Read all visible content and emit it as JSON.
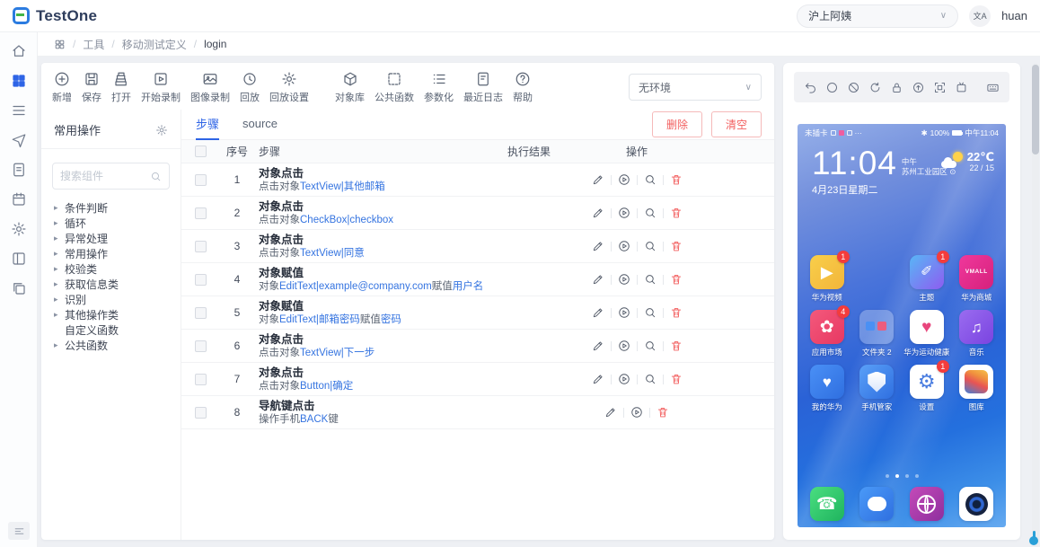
{
  "header": {
    "logo": "TestOne",
    "org": "沪上阿姨",
    "translate": "文A",
    "user": "huan",
    "chevron": "∨"
  },
  "breadcrumb": {
    "items": [
      "工具",
      "移动测试定义",
      "login"
    ],
    "separator": "/"
  },
  "rail": {
    "icons": [
      "home",
      "apps",
      "list",
      "send",
      "doc",
      "calendar",
      "gear",
      "split",
      "windows"
    ],
    "active_index": 1
  },
  "toolbar": {
    "buttons": [
      {
        "label": "新增",
        "icon": "plus"
      },
      {
        "label": "保存",
        "icon": "save"
      },
      {
        "label": "打开",
        "icon": "open"
      },
      {
        "label": "开始录制",
        "icon": "record"
      },
      {
        "label": "图像录制",
        "icon": "image"
      },
      {
        "label": "回放",
        "icon": "history"
      },
      {
        "label": "回放设置",
        "icon": "gear",
        "group": true
      },
      {
        "label": "对象库",
        "icon": "cube",
        "group2": true
      },
      {
        "label": "公共函数",
        "icon": "func"
      },
      {
        "label": "参数化",
        "icon": "params"
      },
      {
        "label": "最近日志",
        "icon": "log"
      },
      {
        "label": "帮助",
        "icon": "help"
      }
    ],
    "env_select": {
      "value": "无环境"
    }
  },
  "library": {
    "title": "常用操作",
    "search_placeholder": "搜索组件",
    "tree": [
      {
        "label": "条件判断",
        "expandable": true
      },
      {
        "label": "循环",
        "expandable": true
      },
      {
        "label": "异常处理",
        "expandable": true
      },
      {
        "label": "常用操作",
        "expandable": true
      },
      {
        "label": "校验类",
        "expandable": true
      },
      {
        "label": "获取信息类",
        "expandable": true
      },
      {
        "label": "识别",
        "expandable": true
      },
      {
        "label": "其他操作类",
        "expandable": true
      },
      {
        "label": "自定义函数",
        "expandable": false
      },
      {
        "label": "公共函数",
        "expandable": true
      }
    ]
  },
  "steps": {
    "tabs": [
      {
        "label": "步骤",
        "active": true
      },
      {
        "label": "source",
        "active": false
      }
    ],
    "action_buttons": [
      "删除",
      "清空"
    ],
    "columns": {
      "index": "序号",
      "step": "步骤",
      "result": "执行结果",
      "ops": "操作"
    },
    "rows": [
      {
        "num": "1",
        "title": "对象点击",
        "detail": [
          {
            "text": "点击对象"
          },
          {
            "text": "TextView|其他邮箱",
            "link": true
          }
        ],
        "ops": [
          "edit",
          "play",
          "search",
          "trash"
        ]
      },
      {
        "num": "2",
        "title": "对象点击",
        "detail": [
          {
            "text": "点击对象"
          },
          {
            "text": "CheckBox|checkbox",
            "link": true
          }
        ],
        "ops": [
          "edit",
          "play",
          "search",
          "trash"
        ]
      },
      {
        "num": "3",
        "title": "对象点击",
        "detail": [
          {
            "text": "点击对象"
          },
          {
            "text": "TextView|同意",
            "link": true
          }
        ],
        "ops": [
          "edit",
          "play",
          "search",
          "trash"
        ]
      },
      {
        "num": "4",
        "title": "对象赋值",
        "detail": [
          {
            "text": "对象"
          },
          {
            "text": "EditText|example@company.com",
            "link": true
          },
          {
            "text": "赋值"
          },
          {
            "text": "用户名",
            "link": true
          }
        ],
        "ops": [
          "edit",
          "play",
          "search",
          "trash"
        ]
      },
      {
        "num": "5",
        "title": "对象赋值",
        "detail": [
          {
            "text": "对象"
          },
          {
            "text": "EditText|邮箱密码",
            "link": true
          },
          {
            "text": "赋值"
          },
          {
            "text": "密码",
            "link": true
          }
        ],
        "ops": [
          "edit",
          "play",
          "search",
          "trash"
        ]
      },
      {
        "num": "6",
        "title": "对象点击",
        "detail": [
          {
            "text": "点击对象"
          },
          {
            "text": "TextView|下一步",
            "link": true
          }
        ],
        "ops": [
          "edit",
          "play",
          "search",
          "trash"
        ]
      },
      {
        "num": "7",
        "title": "对象点击",
        "detail": [
          {
            "text": "点击对象"
          },
          {
            "text": "Button|确定",
            "link": true
          }
        ],
        "ops": [
          "edit",
          "play",
          "search",
          "trash"
        ]
      },
      {
        "num": "8",
        "title": "导航键点击",
        "detail": [
          {
            "text": "操作手机"
          },
          {
            "text": "BACK",
            "link": true
          },
          {
            "text": "键"
          }
        ],
        "ops": [
          "edit",
          "play",
          "trash"
        ]
      }
    ]
  },
  "device": {
    "toolbar_icons": [
      "undo",
      "circle",
      "ban",
      "refresh",
      "lock",
      "upload",
      "scan",
      "rotate"
    ],
    "toolbar_right_icon": "keyboard",
    "status": {
      "left": "未插卡",
      "more": "···",
      "bt": "✱",
      "percent": "100%",
      "time": "中午11:04"
    },
    "clock": {
      "time": "11:04",
      "meridiem": "中午",
      "location": "苏州工业园区 ⊙",
      "date": "4月23日星期二"
    },
    "weather": {
      "temp": "22℃",
      "range": "22 / 15"
    },
    "app_rows": [
      [
        {
          "name": "huawei-video",
          "label": "华为视频",
          "badge": "1",
          "bg": "linear-gradient(135deg,#f9cf4a,#f2b53a)",
          "glyph": "▶",
          "glyph_color": "#ffffff",
          "glyph_size": "18px"
        },
        null,
        {
          "name": "themes",
          "label": "主题",
          "badge": "1",
          "bg": "linear-gradient(135deg,#58b6f6,#8e5cf0)",
          "glyph": "✐",
          "glyph_color": "#ffffff",
          "glyph_size": "16px"
        },
        {
          "name": "huawei-mall",
          "label": "华为商城",
          "bg": "linear-gradient(135deg,#f0389c,#d6217c)",
          "glyph": "VMALL",
          "glyph_color": "#ffffff",
          "glyph_size": "6.5px"
        }
      ],
      [
        {
          "name": "app-market",
          "label": "应用市场",
          "badge": "4",
          "bg": "linear-gradient(135deg,#f4597c,#e73862)",
          "glyph": "✿",
          "glyph_color": "#ffffff",
          "glyph_size": "19px"
        },
        {
          "name": "folder-2",
          "label": "文件夹 2",
          "bg": "rgba(255,255,255,0.28)",
          "shape": "folder"
        },
        {
          "name": "health",
          "label": "华为运动健康",
          "bg": "#ffffff",
          "glyph": "♥",
          "glyph_color": "#e8457c",
          "glyph_size": "19px"
        },
        {
          "name": "music",
          "label": "音乐",
          "bg": "linear-gradient(135deg,#9a6cf0,#7a44e0)",
          "glyph": "♫",
          "glyph_color": "#ffffff",
          "glyph_size": "17px"
        }
      ],
      [
        {
          "name": "my-huawei",
          "label": "我的华为",
          "bg": "linear-gradient(135deg,#4a90f6,#2f6fe0)",
          "glyph": "♥",
          "glyph_color": "#ffffff",
          "glyph_size": "17px"
        },
        {
          "name": "phone-manager",
          "label": "手机管家",
          "bg": "linear-gradient(135deg,#5aa0f8,#2f6fe0)",
          "shape": "shield"
        },
        {
          "name": "settings",
          "label": "设置",
          "badge": "1",
          "bg": "#ffffff",
          "glyph": "⚙",
          "glyph_color": "#4a7de0",
          "glyph_size": "22px"
        },
        {
          "name": "gallery",
          "label": "图库",
          "bg": "#ffffff",
          "shape": "gallery"
        }
      ]
    ],
    "dock": [
      {
        "name": "phone",
        "bg": "linear-gradient(135deg,#4ade80,#1fb45e)",
        "glyph": "☎",
        "glyph_color": "#ffffff",
        "glyph_size": "19px"
      },
      {
        "name": "messages",
        "bg": "linear-gradient(135deg,#4a9af8,#2f6fe0)",
        "shape": "bubble"
      },
      {
        "name": "browser",
        "bg": "linear-gradient(135deg,#c44ab8,#8e2f9e)",
        "shape": "globe"
      },
      {
        "name": "camera",
        "bg": "#ffffff",
        "shape": "camera"
      }
    ],
    "page_dots": {
      "count": 4,
      "active_index": 1
    }
  }
}
